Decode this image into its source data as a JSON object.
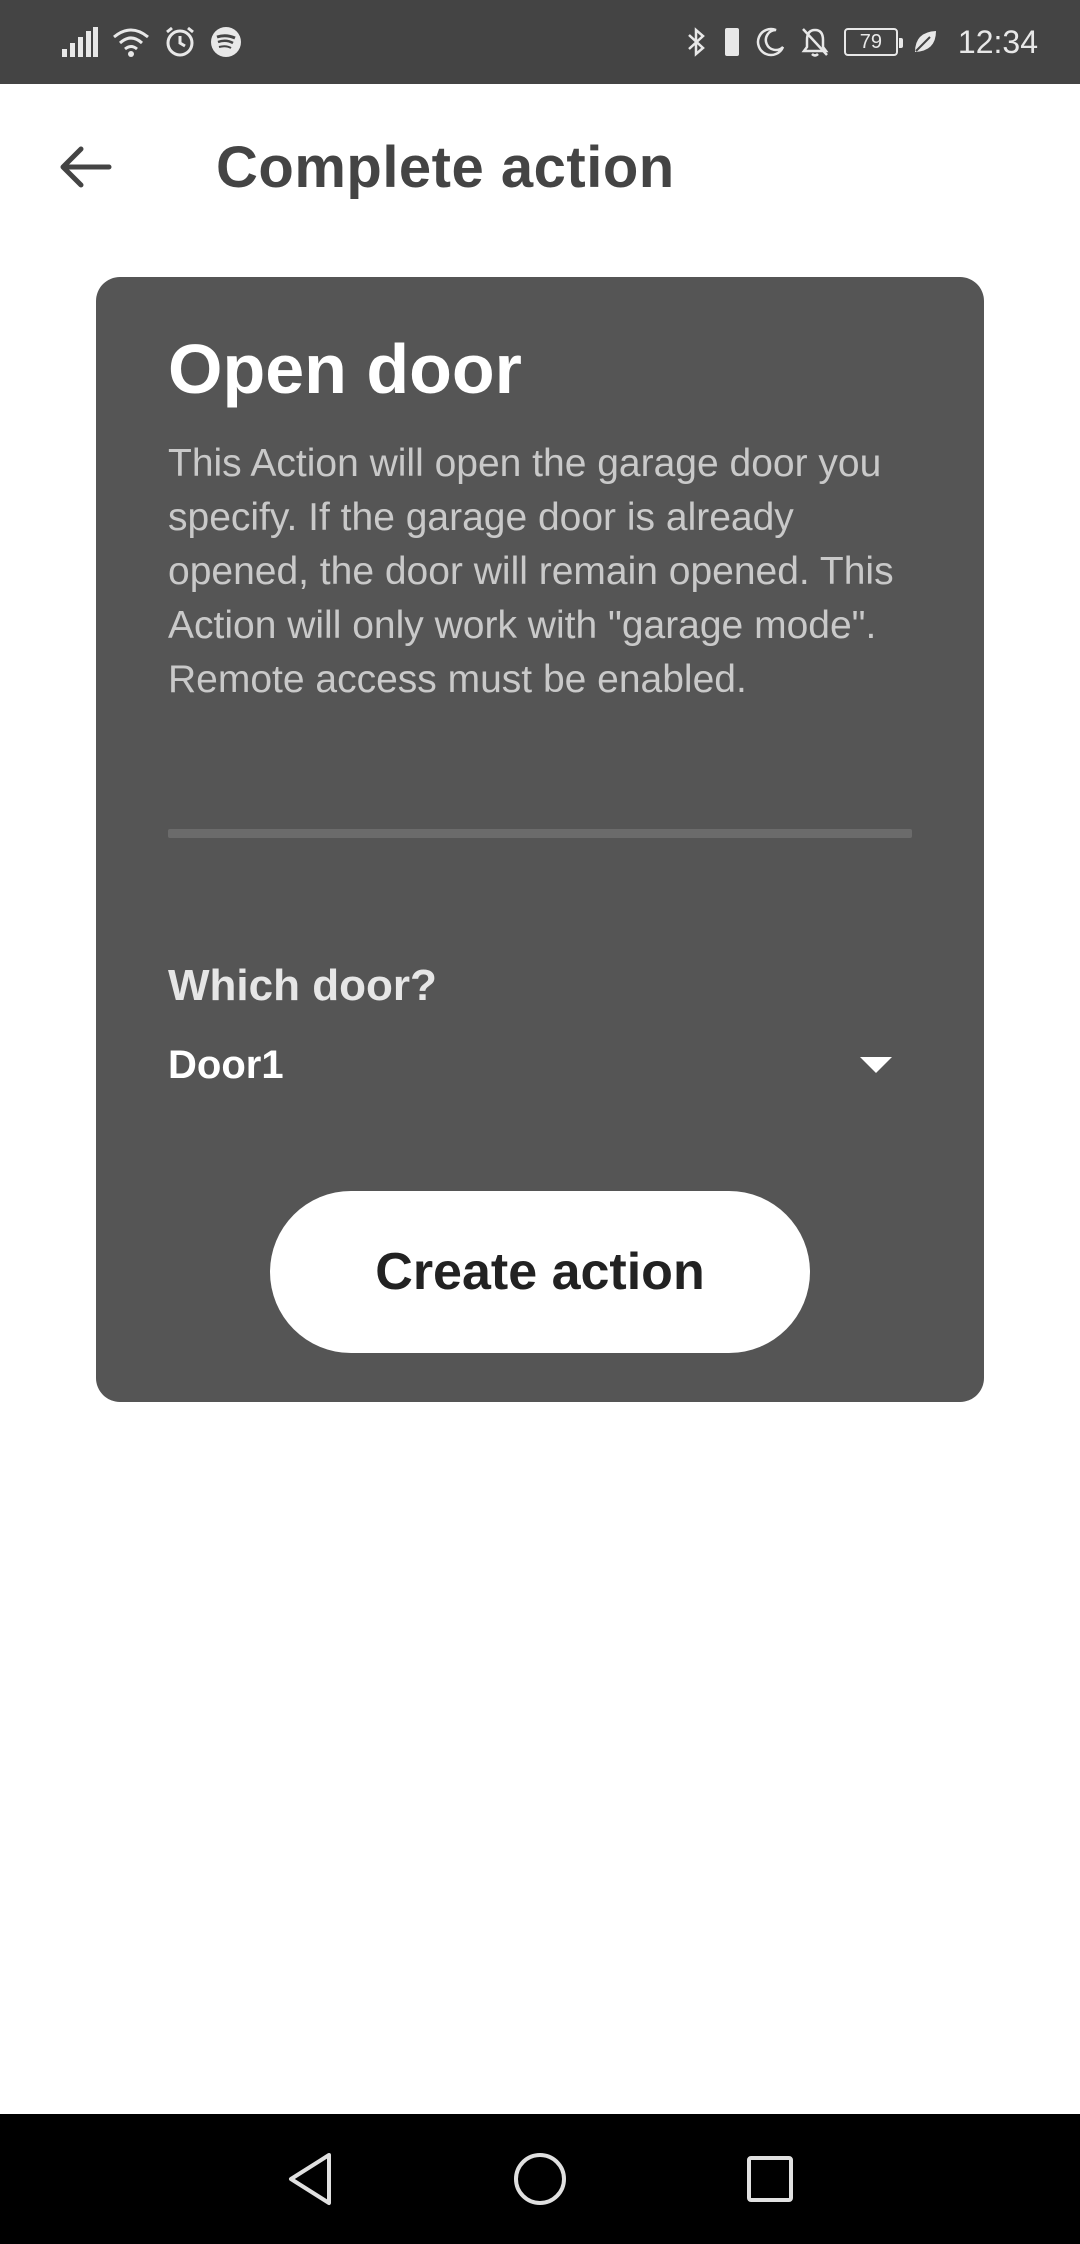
{
  "status_bar": {
    "time": "12:34",
    "battery_level": "79",
    "icons_left": [
      "signal-icon",
      "wifi-icon",
      "alarm-icon",
      "spotify-icon"
    ],
    "icons_right": [
      "bluetooth-icon",
      "vibrate-icon",
      "moon-icon",
      "bell-off-icon",
      "battery-icon",
      "leaf-icon"
    ]
  },
  "app_bar": {
    "title": "Complete action",
    "back_icon": "arrow-back-icon"
  },
  "card": {
    "title": "Open door",
    "description": "This Action will open the garage door you specify. If the garage door is already opened, the door will remain opened. This Action will only work with \"garage mode\". Remote access must be enabled.",
    "field_label": "Which door?",
    "select_value": "Door1",
    "button_label": "Create action"
  },
  "nav_bar": {
    "buttons": [
      "back-triangle-icon",
      "home-circle-icon",
      "recents-square-icon"
    ]
  },
  "colors": {
    "status_bar_bg": "#444444",
    "card_bg": "#555555",
    "title_text": "#444444",
    "nav_bar_bg": "#000000",
    "button_bg": "#ffffff"
  }
}
